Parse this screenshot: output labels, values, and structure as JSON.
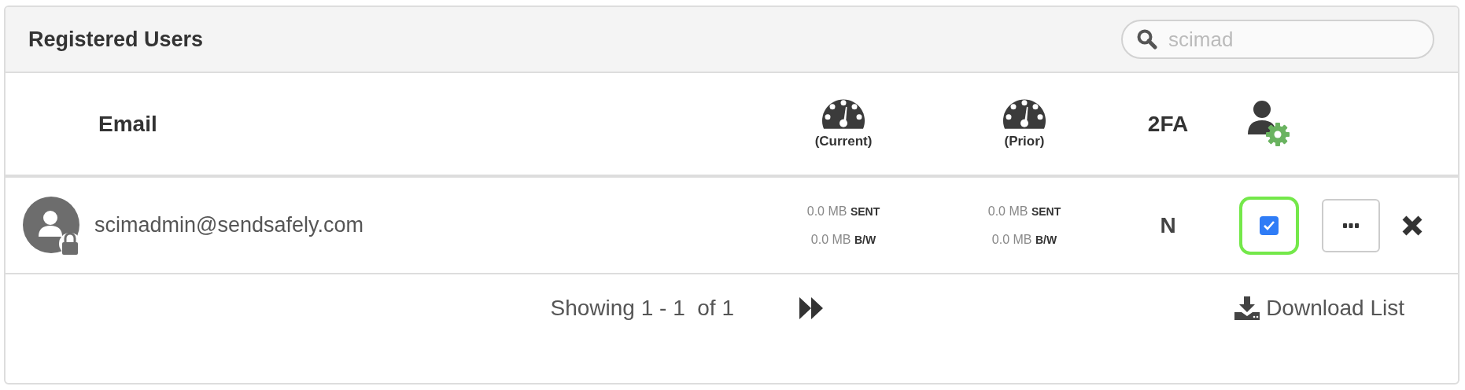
{
  "panel": {
    "title": "Registered Users"
  },
  "search": {
    "value": "scimad"
  },
  "columns": [
    {
      "kind": "text",
      "label": "Email"
    },
    {
      "kind": "gauge",
      "label": "(Current)"
    },
    {
      "kind": "gauge",
      "label": "(Prior)"
    },
    {
      "kind": "text",
      "label": "2FA"
    },
    {
      "kind": "admin"
    }
  ],
  "rows": [
    {
      "email": "scimadmin@sendsafely.com",
      "locked": true,
      "usage": [
        {
          "sent": "0.0 MB",
          "sent_unit": "SENT",
          "bw": "0.0 MB",
          "bw_unit": "B/W"
        },
        {
          "sent": "0.0 MB",
          "sent_unit": "SENT",
          "bw": "0.0 MB",
          "bw_unit": "B/W"
        }
      ],
      "two_fa": "N",
      "admin_checked": true,
      "admin_focused": true
    }
  ],
  "footer": {
    "showing": "Showing 1 - 1  of 1",
    "download": "Download List"
  }
}
